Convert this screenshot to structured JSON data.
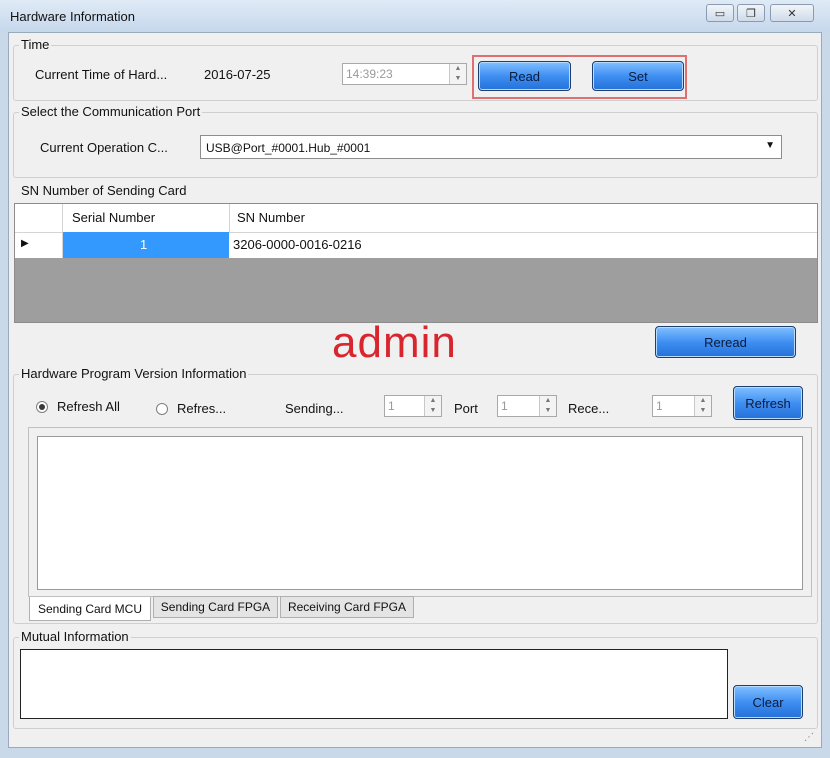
{
  "window": {
    "title": "Hardware Information",
    "minimize_glyph": "▭",
    "restore_glyph": "❐",
    "close_glyph": "✕"
  },
  "time_group": {
    "label": "Time",
    "current_time_label": "Current Time of Hard...",
    "date_value": "2016-07-25",
    "time_value": "14:39:23",
    "read_label": "Read",
    "set_label": "Set"
  },
  "port_group": {
    "label": "Select the Communication Port",
    "operation_label": "Current Operation C...",
    "selected_port": "USB@Port_#0001.Hub_#0001"
  },
  "sn_group": {
    "label": "SN Number of Sending Card",
    "columns": [
      "Serial Number",
      "SN Number"
    ],
    "rows": [
      {
        "serial": "1",
        "sn": "3206-0000-0016-0216"
      }
    ],
    "reread_label": "Reread"
  },
  "watermark": "admin",
  "version_group": {
    "label": "Hardware Program Version Information",
    "refresh_all_label": "Refresh All",
    "refresh_partial_label": "Refres...",
    "sending_label": "Sending...",
    "sending_value": "1",
    "port_label": "Port",
    "port_value": "1",
    "receiving_label": "Rece...",
    "receiving_value": "1",
    "refresh_button_label": "Refresh",
    "tabs": [
      "Sending Card MCU",
      "Sending Card FPGA",
      "Receiving Card FPGA"
    ]
  },
  "mutual_group": {
    "label": "Mutual Information",
    "clear_label": "Clear"
  },
  "colors": {
    "highlight_box": "#e07070",
    "selected_cell": "#3399ff",
    "watermark": "#d9262e"
  }
}
